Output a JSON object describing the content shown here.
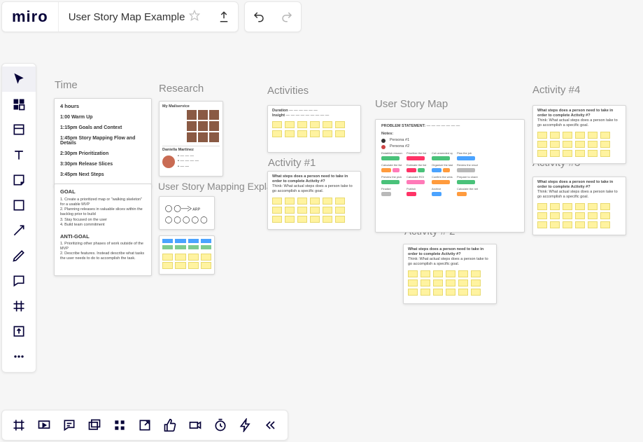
{
  "header": {
    "logo": "miro",
    "board_title": "User Story Map Example"
  },
  "toolbar_left": [
    {
      "name": "select-tool",
      "icon": "cursor",
      "active": true
    },
    {
      "name": "templates-tool",
      "icon": "templates"
    },
    {
      "name": "frame-tool",
      "icon": "frame"
    },
    {
      "name": "text-tool",
      "icon": "text"
    },
    {
      "name": "sticky-tool",
      "icon": "sticky"
    },
    {
      "name": "shape-tool",
      "icon": "shape"
    },
    {
      "name": "connector-tool",
      "icon": "arrow"
    },
    {
      "name": "pen-tool",
      "icon": "pen"
    },
    {
      "name": "comment-tool",
      "icon": "comment"
    },
    {
      "name": "grid-tool",
      "icon": "grid"
    },
    {
      "name": "upload-tool",
      "icon": "upload"
    },
    {
      "name": "more-tool",
      "icon": "dots"
    }
  ],
  "toolbar_bottom": [
    {
      "name": "frames-panel",
      "icon": "frames"
    },
    {
      "name": "present",
      "icon": "present"
    },
    {
      "name": "comments-panel",
      "icon": "comments"
    },
    {
      "name": "cards",
      "icon": "cards"
    },
    {
      "name": "apps",
      "icon": "apps"
    },
    {
      "name": "share-embed",
      "icon": "shareout"
    },
    {
      "name": "voting",
      "icon": "thumb"
    },
    {
      "name": "video",
      "icon": "video"
    },
    {
      "name": "timer",
      "icon": "timer"
    },
    {
      "name": "bolt",
      "icon": "bolt"
    },
    {
      "name": "collapse",
      "icon": "chevrons"
    }
  ],
  "canvas": {
    "sections": {
      "time": "Time",
      "research": "Research",
      "activities": "Activities",
      "user_story_map": "User Story Map",
      "activity4": "Activity #4",
      "activity1": "Activity #1",
      "activity3": "Activity #3",
      "activity2": "Activity # 2",
      "goal": "Goal",
      "usm_explained": "User Story Mapping Expla"
    },
    "time_frame": {
      "duration": "4 hours",
      "rows": [
        "1:00 Warm Up",
        "1:15pm Goals and Context",
        "1:45pm Story Mapping Flow and Details",
        "2:30pm Prioritization",
        "3:30pm Release Slices",
        "3:45pm Next Steps"
      ]
    },
    "goal_frame": {
      "heading": "GOAL",
      "goals": [
        "1. Create a prioritized map or \"walking skeleton\" for a usable MVP",
        "2. Planning releases in valuable slices within the backlog prior to build",
        "3. Stay focused on the user",
        "4. Build team commitment"
      ],
      "anti_heading": "ANTI-GOAL",
      "anti": [
        "1. Prioritizing other phases of work outside of the MVP",
        "2. Describe features. Instead describe what tasks the user needs to do to accomplish the task."
      ]
    },
    "research_top": {
      "title": "My Mailservice",
      "name": "Daniella  Martinez"
    },
    "arrow_label": "ARP",
    "activity_frame": {
      "header1": "Duration",
      "header2": "Insight",
      "task_line": "What steps does a person need to take in order to complete Activity #?",
      "think_line": "Think: What actual steps does a person take to go accomplish a specific goal."
    },
    "usm_frame": {
      "problem": "PROBLEM STATEMENT:",
      "notes": "Notes:",
      "persona_a": "Persona #1",
      "persona_b": "Persona #2",
      "row1": [
        "Establish resources",
        "Prioritize the list",
        "Cut unneeded options",
        "Plan the job"
      ],
      "row2": [
        "Calculate the list",
        "Estimate the list",
        "Organize the tasks",
        "Review the result"
      ],
      "row3": [
        "Preview the pick",
        "Calculate ROI",
        "Confirm the wins",
        "Prepare to share"
      ],
      "row4": [
        "Finalize",
        "Publish",
        "Archive",
        "Calculate the net"
      ]
    }
  }
}
